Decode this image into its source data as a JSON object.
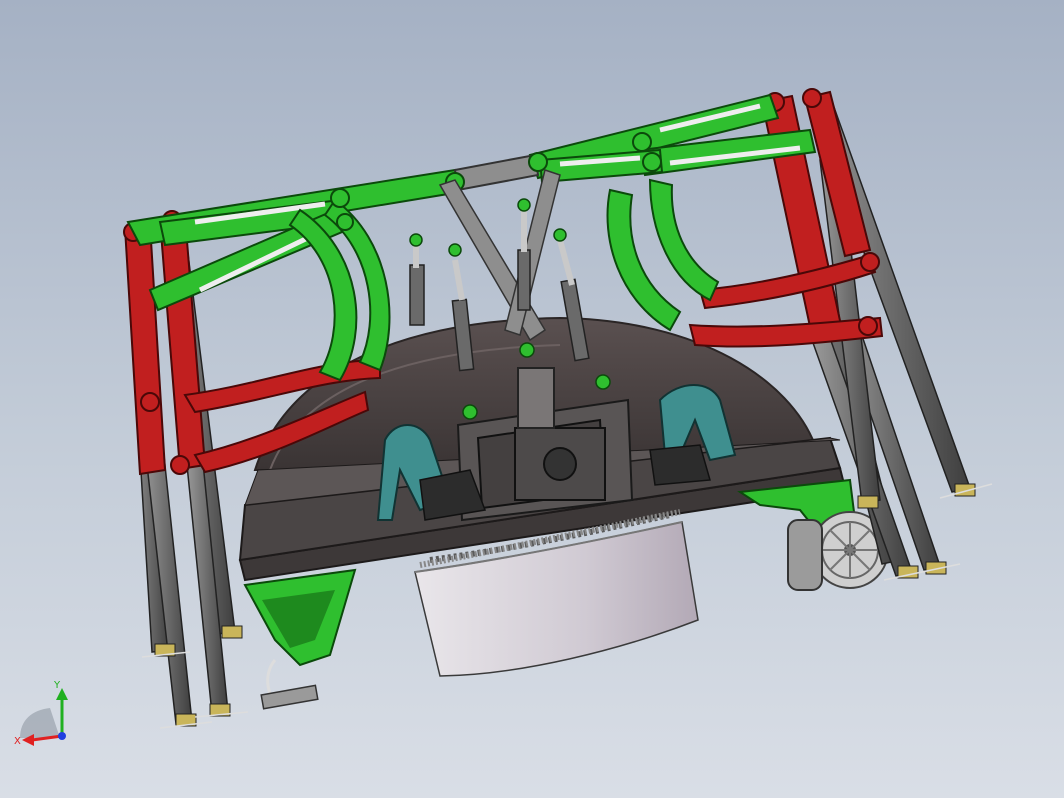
{
  "viewport": {
    "background_top": "#a5b1c4",
    "background_bottom": "#d9dee6"
  },
  "colors": {
    "green": "#2fbf2f",
    "red": "#c11f1f",
    "teal": "#3f8f8f",
    "gray_rod": "#7f7f7f",
    "dark_base": "#4a4646",
    "cylinder": "#c9c3cc"
  },
  "triad": {
    "x_label": "X",
    "y_label": "Y",
    "x_color": "#e02020",
    "y_color": "#20b020",
    "z_color": "#2040e0"
  }
}
